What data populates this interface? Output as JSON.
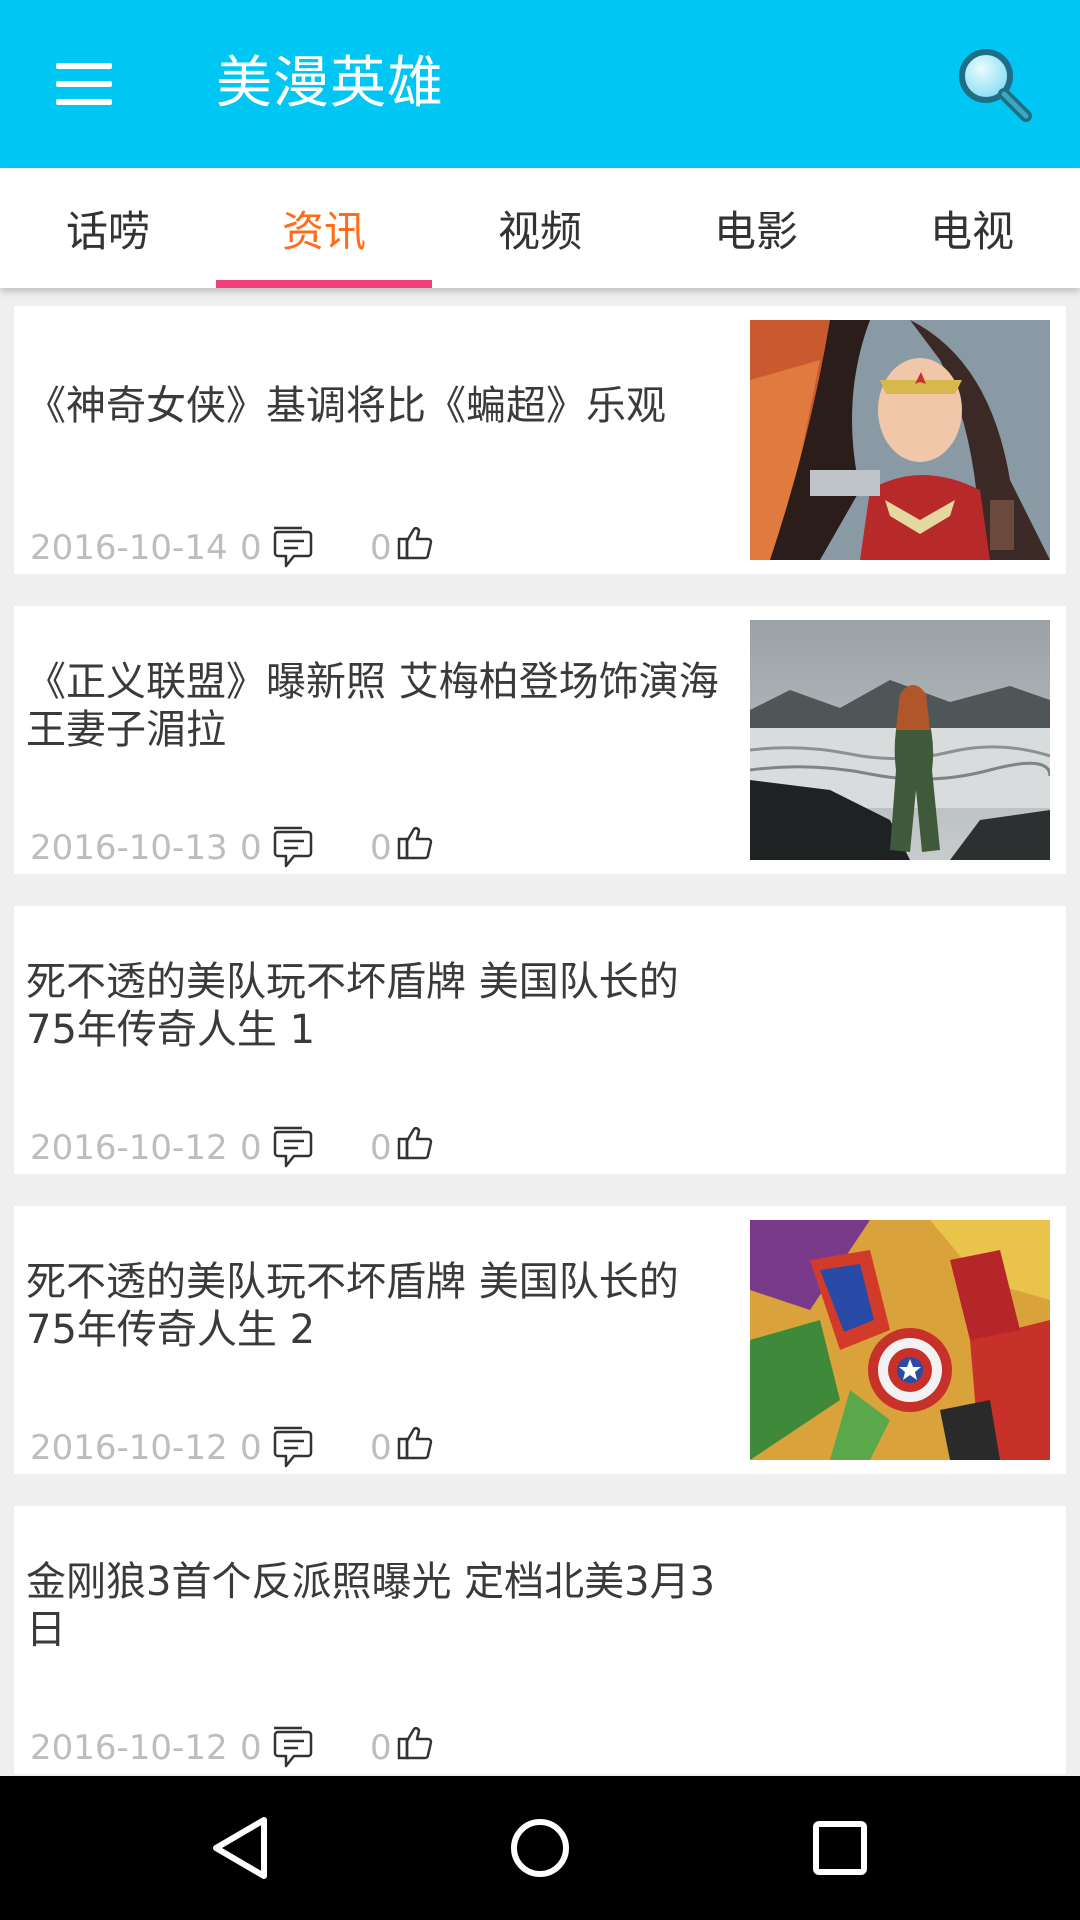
{
  "app": {
    "title": "美漫英雄",
    "menu_icon": "hamburger-menu-icon",
    "search_icon": "search-icon",
    "theme_color": "#00c6f3"
  },
  "tabs": [
    {
      "label": "话唠",
      "active": false
    },
    {
      "label": "资讯",
      "active": true
    },
    {
      "label": "视频",
      "active": false
    },
    {
      "label": "电影",
      "active": false
    },
    {
      "label": "电视",
      "active": false
    }
  ],
  "colors": {
    "active_tab_text": "#ff6d1a",
    "active_tab_indicator": "#f0407a",
    "meta_text": "#bdbdbd"
  },
  "articles": [
    {
      "title_lines": [
        "《神奇女侠》基调将比《蝙超》乐观"
      ],
      "date": "2016-10-14",
      "comments": "0",
      "likes": "0",
      "thumbnail": "wonder-woman-illustration"
    },
    {
      "title_lines": [
        "《正义联盟》曝新照 艾梅柏登场饰演海",
        "王妻子湄拉"
      ],
      "date": "2016-10-13",
      "comments": "0",
      "likes": "0",
      "thumbnail": "mera-on-shore-photo"
    },
    {
      "title_lines": [
        "死不透的美队玩不坏盾牌 美国队长的",
        "75年传奇人生 1"
      ],
      "date": "2016-10-12",
      "comments": "0",
      "likes": "0",
      "thumbnail": null
    },
    {
      "title_lines": [
        "死不透的美队玩不坏盾牌 美国队长的",
        "75年传奇人生 2"
      ],
      "date": "2016-10-12",
      "comments": "0",
      "likes": "0",
      "thumbnail": "marvel-heroes-collage"
    },
    {
      "title_lines": [
        "金刚狼3首个反派照曝光 定档北美3月3",
        "日"
      ],
      "date": "2016-10-12",
      "comments": "0",
      "likes": "0",
      "thumbnail": null
    }
  ],
  "navbar": {
    "back_icon": "back-triangle-icon",
    "home_icon": "home-circle-icon",
    "recents_icon": "recents-square-icon"
  }
}
